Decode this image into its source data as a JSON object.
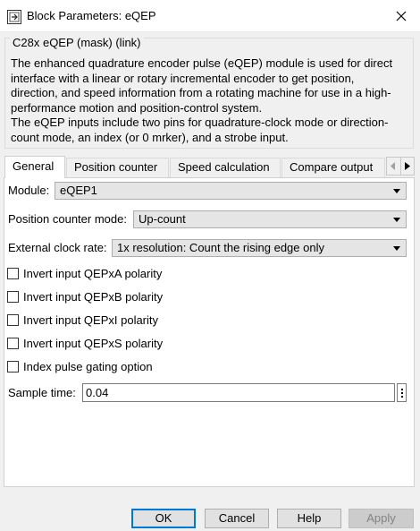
{
  "window": {
    "title": "Block Parameters: eQEP",
    "icon": "simulink-block-icon",
    "close_icon": "close-icon"
  },
  "description": {
    "group_label": "C28x eQEP (mask) (link)",
    "text": "The enhanced quadrature encoder pulse (eQEP) module is used for direct\ninterface with a linear or rotary incremental encoder to get position,\ndirection, and speed information from a rotating machine for use in a high-\nperformance motion and position-control system.\nThe eQEP inputs include two pins for quadrature-clock mode or direction-\ncount mode, an index (or 0 mrker), and a strobe input."
  },
  "tabs": [
    {
      "label": "General",
      "active": true
    },
    {
      "label": "Position counter",
      "active": false
    },
    {
      "label": "Speed calculation",
      "active": false
    },
    {
      "label": "Compare output",
      "active": false
    }
  ],
  "tab_scroll": {
    "left_icon": "chevron-left-icon",
    "right_icon": "chevron-right-icon"
  },
  "general": {
    "module": {
      "label": "Module:",
      "value": "eQEP1"
    },
    "position_counter_mode": {
      "label": "Position counter mode:",
      "value": "Up-count"
    },
    "external_clock_rate": {
      "label": "External clock rate:",
      "value": "1x resolution: Count the rising edge only"
    },
    "checkboxes": [
      {
        "label": "Invert input QEPxA polarity",
        "checked": false
      },
      {
        "label": "Invert input QEPxB polarity",
        "checked": false
      },
      {
        "label": "Invert input QEPxI polarity",
        "checked": false
      },
      {
        "label": "Invert input QEPxS polarity",
        "checked": false
      },
      {
        "label": "Index pulse gating option",
        "checked": false
      }
    ],
    "sample_time": {
      "label": "Sample time:",
      "value": "0.04",
      "more_icon": "vertical-ellipsis-icon"
    }
  },
  "buttons": {
    "ok": "OK",
    "cancel": "Cancel",
    "help": "Help",
    "apply": "Apply"
  },
  "colors": {
    "dialog_background": "#f0f0f0",
    "panel_background": "#ffffff",
    "default_button_border": "#0078d7",
    "disabled_text": "#838383"
  }
}
